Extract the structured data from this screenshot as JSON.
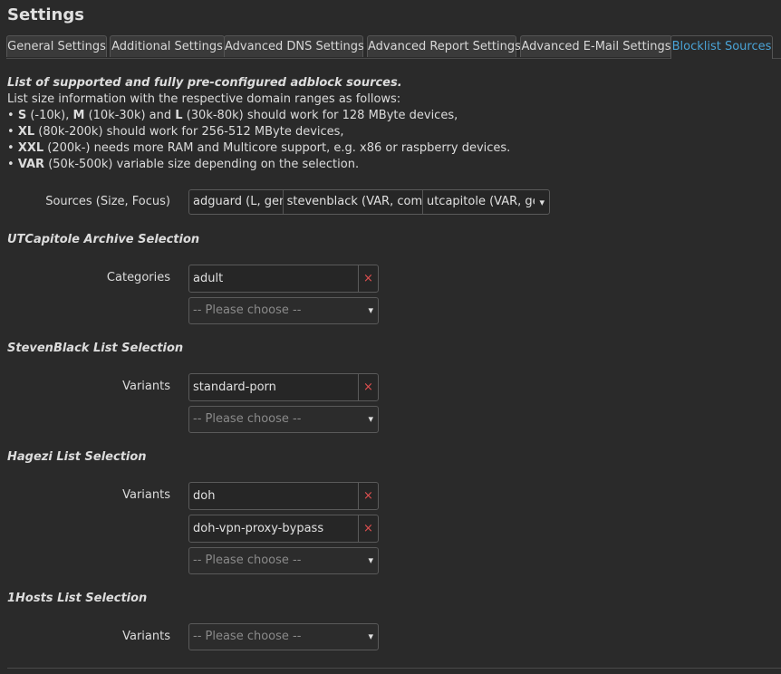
{
  "page": {
    "title": "Settings"
  },
  "tabs": [
    {
      "label": "General Settings"
    },
    {
      "label": "Additional Settings"
    },
    {
      "label": "Advanced DNS Settings"
    },
    {
      "label": "Advanced Report Settings"
    },
    {
      "label": "Advanced E-Mail Settings"
    },
    {
      "label": "Blocklist Sources"
    }
  ],
  "active_tab": "Blocklist Sources",
  "colors": {
    "accent": "#4aa3d6",
    "remove": "#e05050",
    "background": "#2a2a2a"
  },
  "intro": {
    "lead": "List of supported and fully pre-configured adblock sources.",
    "line1": "List size information with the respective domain ranges as follows:",
    "bullet": "•",
    "b1": {
      "s": "S",
      "s_range": "(-10k), ",
      "m": "M",
      "m_range": "(10k-30k) and ",
      "l": "L",
      "rest": "(30k-80k) should work for 128 MByte devices,"
    },
    "b2": {
      "key": "XL",
      "rest": "(80k-200k) should work for 256-512 MByte devices,"
    },
    "b3": {
      "key": "XXL",
      "rest": "(200k-) needs more RAM and Multicore support, e.g. x86 or raspberry devices."
    },
    "b4": {
      "key": "VAR",
      "rest": "(50k-500k) variable size depending on the selection."
    }
  },
  "sources": {
    "label": "Sources (Size, Focus)",
    "chips": [
      "adguard (L, general)",
      "stevenblack (VAR, compilation)",
      "utcapitole (VAR, general)"
    ],
    "arrow": "▾"
  },
  "utcapitole": {
    "heading": "UTCapitole Archive Selection",
    "label": "Categories",
    "tags": [
      "adult"
    ],
    "placeholder": "-- Please choose --"
  },
  "stevenblack": {
    "heading": "StevenBlack List Selection",
    "label": "Variants",
    "tags": [
      "standard-porn"
    ],
    "placeholder": "-- Please choose --"
  },
  "hagezi": {
    "heading": "Hagezi List Selection",
    "label": "Variants",
    "tags": [
      "doh",
      "doh-vpn-proxy-bypass"
    ],
    "placeholder": "-- Please choose --"
  },
  "onehosts": {
    "heading": "1Hosts List Selection",
    "label": "Variants",
    "placeholder": "-- Please choose --"
  },
  "remove_glyph": "×",
  "select_arrow": "▾"
}
